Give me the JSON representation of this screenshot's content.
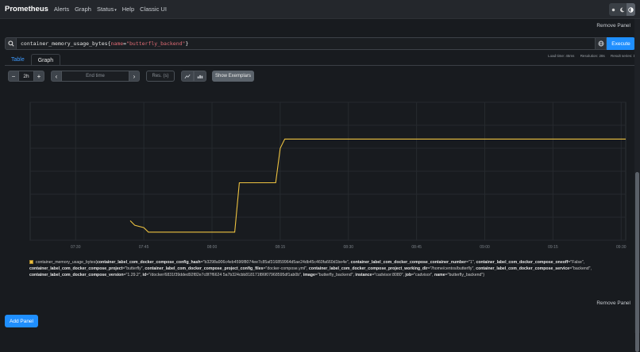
{
  "navbar": {
    "brand": "Prometheus",
    "links": [
      "Alerts",
      "Graph",
      "Status",
      "Help",
      "Classic UI"
    ],
    "status_caret": "▾"
  },
  "panel": {
    "remove_label": "Remove Panel",
    "expression": {
      "prefix": "container_memory_usage_bytes{",
      "label": "name",
      "op": "=",
      "value": "\"butterfly_backend\"",
      "suffix": "}"
    },
    "execute_label": "Execute",
    "tabs": [
      "Table",
      "Graph"
    ],
    "active_tab": "Graph",
    "stats": {
      "load_time": "Load time: 45ms",
      "resolution": "Resolution: 28s",
      "result_series": "Result series: 1"
    },
    "controls": {
      "minus": "−",
      "range": "2h",
      "plus": "+",
      "prev": "‹",
      "end_time_placeholder": "End time",
      "next": "›",
      "res_placeholder": "Res. (s)",
      "exemplars_label": "Show Exemplars"
    }
  },
  "chart_data": {
    "type": "line",
    "x_ticks": [
      "07:30",
      "07:45",
      "08:00",
      "08:15",
      "08:30",
      "08:45",
      "09:00",
      "09:15",
      "09:30"
    ],
    "xlim": [
      "07:20",
      "09:31"
    ],
    "ylim": [
      0,
      6
    ],
    "grid": true,
    "series": [
      {
        "color": "#edc240",
        "points": [
          [
            "07:42",
            0.85
          ],
          [
            "07:43",
            0.65
          ],
          [
            "07:45",
            0.55
          ],
          [
            "07:46",
            0.35
          ],
          [
            "08:05",
            0.35
          ],
          [
            "08:06",
            2.5
          ],
          [
            "08:14",
            2.5
          ],
          [
            "08:15",
            4.0
          ],
          [
            "08:16",
            4.4
          ],
          [
            "09:31",
            4.4
          ]
        ]
      }
    ]
  },
  "legend": {
    "metric": "container_memory_usage_bytes{",
    "labels": [
      {
        "k": "container_label_com_docker_compose_config_hash",
        "v": "\"b3298a906c4eb4596f8074ee7c85af316859964d5ae24db45c460fa660d1be4e\""
      },
      {
        "k": "container_label_com_docker_compose_container_number",
        "v": "\"1\""
      },
      {
        "k": "container_label_com_docker_compose_oneoff",
        "v": "\"False\""
      },
      {
        "k": "container_label_com_docker_compose_project",
        "v": "\"butterfly\""
      },
      {
        "k": "container_label_com_docker_compose_project_config_files",
        "v": "\"docker-compose.yml\""
      },
      {
        "k": "container_label_com_docker_compose_project_working_dir",
        "v": "\"/home/centos/butterfly\""
      },
      {
        "k": "container_label_com_docker_compose_service",
        "v": "\"backend\""
      },
      {
        "k": "container_label_com_docker_compose_version",
        "v": "\"1.29.2\""
      },
      {
        "k": "id",
        "v": "\"/docker/6831f39dded92f82e7c8f7f6624 5a7b324cbb818171f86f07968595df1ab0b\""
      },
      {
        "k": "image",
        "v": "\"butterfly_backend\""
      },
      {
        "k": "instance",
        "v": "\"cadvisor:8080\""
      },
      {
        "k": "job",
        "v": "\"cadvisor\""
      },
      {
        "k": "name",
        "v": "\"butterfly_backend\""
      }
    ],
    "suffix": "}"
  },
  "add_panel_label": "Add Panel"
}
